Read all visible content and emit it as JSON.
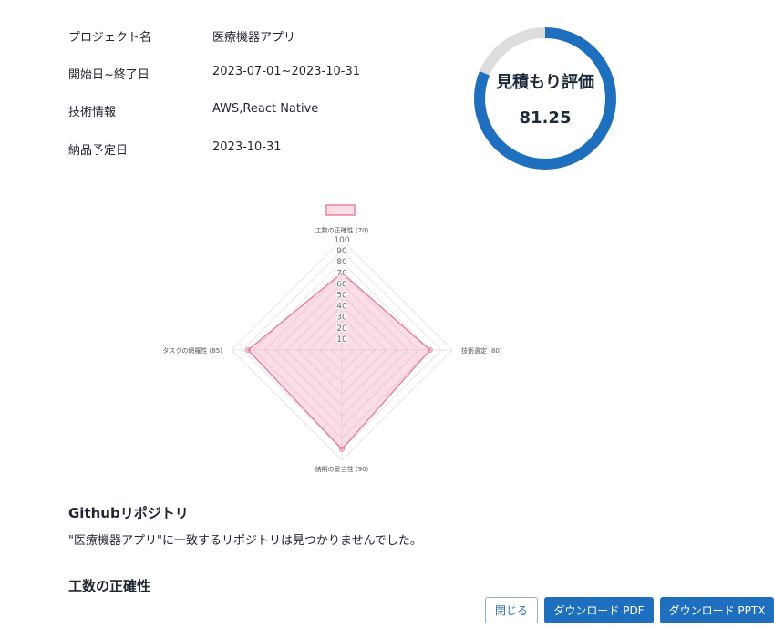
{
  "project": {
    "rows": [
      {
        "label": "プロジェクト名",
        "value": "医療機器アプリ"
      },
      {
        "label": "開始日~終了日",
        "value": "2023-07-01~2023-10-31"
      },
      {
        "label": "技術情報",
        "value": "AWS,React Native"
      },
      {
        "label": "納品予定日",
        "value": "2023-10-31"
      }
    ]
  },
  "score": {
    "title": "見積もり評価",
    "value": "81.25",
    "fraction": 0.8125,
    "ring_color": "#1f6fbf",
    "track_color": "#dddddd"
  },
  "chart_data": {
    "type": "radar",
    "categories": [
      "工数の正確性 (70)",
      "技術選定 (80)",
      "納期の妥当性 (90)",
      "タスクの網羅性 (85)"
    ],
    "values": [
      70,
      80,
      90,
      85
    ],
    "ticks": [
      "10",
      "20",
      "30",
      "40",
      "50",
      "60",
      "70",
      "80",
      "90",
      "100"
    ],
    "range": [
      0,
      100
    ],
    "legend_position": "top",
    "fill_color": "rgba(240,120,150,0.25)",
    "line_color": "#e7859c"
  },
  "github": {
    "title": "Githubリポジトリ",
    "message": "\"医療機器アプリ\"に一致するリポジトリは見つかりませんでした。"
  },
  "accuracy": {
    "title": "工数の正確性"
  },
  "buttons": {
    "close": "閉じる",
    "pdf": "ダウンロード PDF",
    "pptx": "ダウンロード PPTX"
  }
}
